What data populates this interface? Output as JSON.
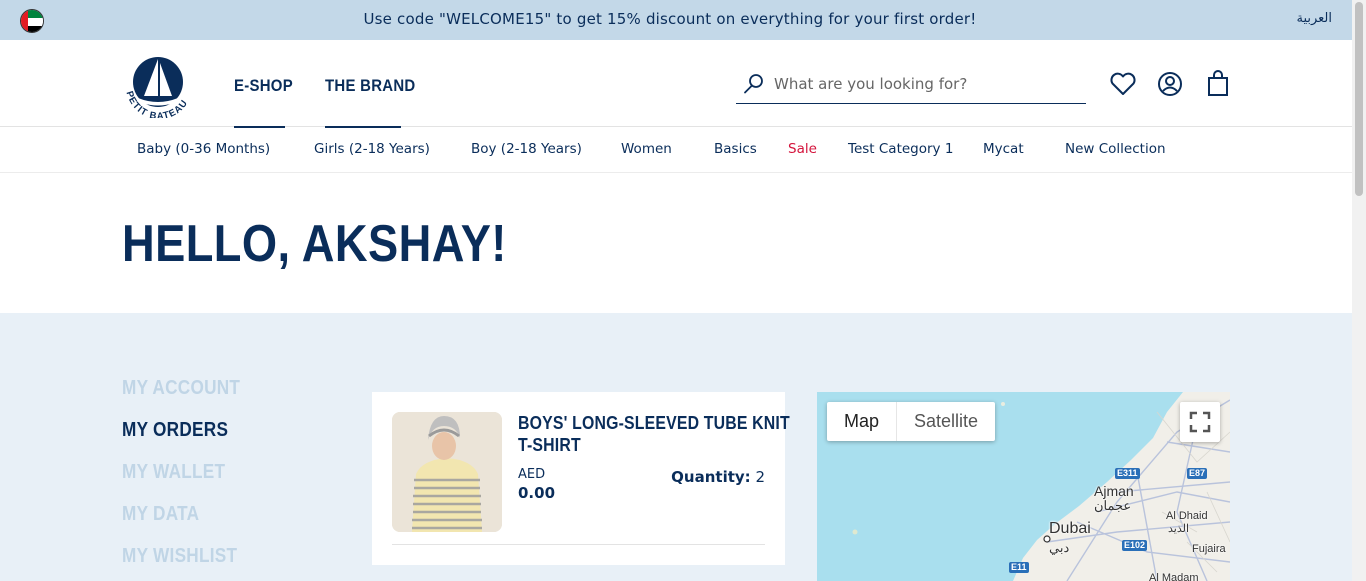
{
  "promo": {
    "message": "Use code \"WELCOME15\" to get 15% discount on everything for your first order!",
    "language_link": "العربية",
    "flag": "uae-flag-icon"
  },
  "header": {
    "logo_text": "PETIT BATEAU",
    "nav": [
      {
        "label": "E-SHOP"
      },
      {
        "label": "THE BRAND"
      }
    ],
    "search_placeholder": "What are you looking for?",
    "icons": [
      "search-icon",
      "heart-icon",
      "account-icon",
      "bag-icon"
    ]
  },
  "categories": [
    {
      "label": "Baby (0-36 Months)"
    },
    {
      "label": "Girls (2-18 Years)"
    },
    {
      "label": "Boy (2-18 Years)"
    },
    {
      "label": "Women"
    },
    {
      "label": "Basics"
    },
    {
      "label": "Sale",
      "color": "#d4143c"
    },
    {
      "label": "Test Category 1"
    },
    {
      "label": "Mycat"
    },
    {
      "label": "New Collection"
    }
  ],
  "greeting": "HELLO, AKSHAY!",
  "sidebar": {
    "items": [
      {
        "label": "MY ACCOUNT",
        "active": false
      },
      {
        "label": "MY ORDERS",
        "active": true
      },
      {
        "label": "MY WALLET",
        "active": false
      },
      {
        "label": "MY DATA",
        "active": false
      },
      {
        "label": "MY WISHLIST",
        "active": false
      }
    ]
  },
  "order": {
    "product_name": [
      "BOYS' LONG-SLEEVED TUBE KNIT",
      "T-SHIRT"
    ],
    "currency": "AED",
    "price": "0.00",
    "quantity_label": "Quantity:",
    "quantity": "2"
  },
  "map": {
    "toggle": [
      "Map",
      "Satellite"
    ],
    "places": [
      "Ajman",
      "عجمان",
      "Dubai",
      "دبي",
      "Al Dhaid",
      "الذيد",
      "Fujaira",
      "Al Madam"
    ],
    "roads": [
      "E311",
      "E87",
      "E102",
      "E11"
    ]
  },
  "colors": {
    "brand_navy": "#0a2d5a",
    "promo_bg": "#c3d8e8",
    "content_bg": "#e8f0f7",
    "sale_red": "#d4143c",
    "inactive_sidebar": "#c0d5e6"
  }
}
